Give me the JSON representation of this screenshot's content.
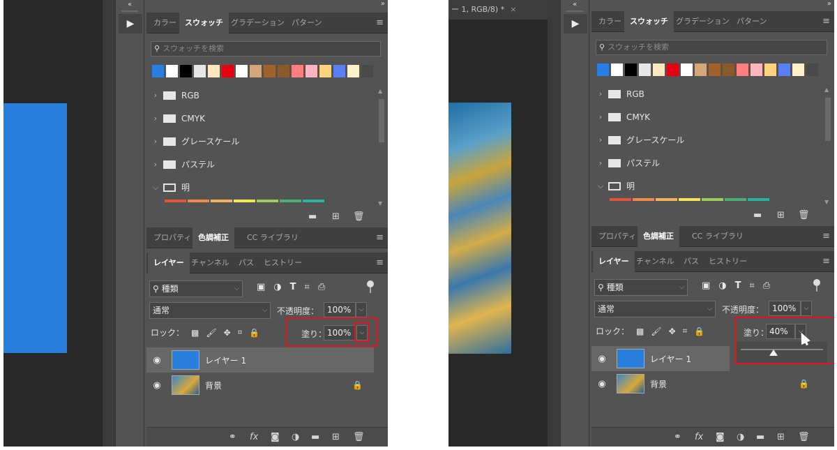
{
  "colors": {
    "fill_layer": "#2b7fdc",
    "highlight": "#e0141e",
    "panel_bg": "#535353",
    "canvas_bg": "#282828"
  },
  "left": {
    "collapse_icon": "«",
    "expand_icon": "»",
    "play_icon": "▶",
    "swatch_tabs": [
      "カラー",
      "スウォッチ",
      "グラデーション",
      "パターン"
    ],
    "swatch_search_placeholder": "スウォッチを検索",
    "swatch_colors": [
      "#2a7de1",
      "#ffffff",
      "#000000",
      "#e6e6e6",
      "#ffe8c0",
      "#e60012",
      "#ffffff",
      "#d4a77a",
      "#a0622d",
      "#8b5a2b",
      "#ff7f7f",
      "#ffb5c0",
      "#ffd27f",
      "#5a7ff0",
      "#fff0cc"
    ],
    "folders": [
      {
        "label": "RGB",
        "open": false
      },
      {
        "label": "CMYK",
        "open": false
      },
      {
        "label": "グレースケール",
        "open": false
      },
      {
        "label": "パステル",
        "open": false
      },
      {
        "label": "明",
        "open": true
      }
    ],
    "adjust_tabs": [
      "プロパティ",
      "色調補正",
      "CC ライブラリ"
    ],
    "layer_tabs": [
      "レイヤー",
      "チャンネル",
      "パス",
      "ヒストリー"
    ],
    "filter_kind": "種類",
    "blend_mode": "通常",
    "opacity_label": "不透明度：",
    "opacity_value": "100%",
    "lock_label": "ロック：",
    "fill_label": "塗り：",
    "fill_value": "100%",
    "layers": [
      {
        "name": "レイヤー 1",
        "selected": true,
        "locked": false
      },
      {
        "name": "背景",
        "selected": false,
        "locked": true
      }
    ]
  },
  "right": {
    "doc_tab_title": "ー 1, RGB/8) *",
    "doc_tab_close": "×",
    "collapse_icon": "«",
    "expand_icon": "»",
    "play_icon": "▶",
    "swatch_tabs": [
      "カラー",
      "スウォッチ",
      "グラデーション",
      "パターン"
    ],
    "swatch_search_placeholder": "スウォッチを検索",
    "swatch_colors": [
      "#2a7de1",
      "#ffffff",
      "#000000",
      "#e6e6e6",
      "#ffe8c0",
      "#e60012",
      "#ffffff",
      "#d4a77a",
      "#a0622d",
      "#8b5a2b",
      "#ff7f7f",
      "#ffb5c0",
      "#ffd27f",
      "#5a7ff0",
      "#fff0cc"
    ],
    "folders": [
      {
        "label": "RGB",
        "open": false
      },
      {
        "label": "CMYK",
        "open": false
      },
      {
        "label": "グレースケール",
        "open": false
      },
      {
        "label": "パステル",
        "open": false
      },
      {
        "label": "明",
        "open": true
      }
    ],
    "adjust_tabs": [
      "プロパティ",
      "色調補正",
      "CC ライブラリ"
    ],
    "layer_tabs": [
      "レイヤー",
      "チャンネル",
      "パス",
      "ヒストリー"
    ],
    "filter_kind": "種類",
    "blend_mode": "通常",
    "opacity_label": "不透明度：",
    "opacity_value": "100%",
    "lock_label": "ロック：",
    "fill_label": "塗り：",
    "fill_value": "40%",
    "fill_slider_level": 0.4,
    "layers": [
      {
        "name": "レイヤー 1",
        "selected": true,
        "locked": false
      },
      {
        "name": "背景",
        "selected": false,
        "locked": true
      }
    ]
  },
  "swatch_strip_colors": [
    "#e0543a",
    "#f08a4b",
    "#f6b25a",
    "#f3e55a",
    "#9ccc5a",
    "#4caf7a",
    "#2bb3a0"
  ],
  "icons": {
    "search": "search-icon",
    "folder": "folder-icon",
    "eye": "eye-icon",
    "lock": "lock-icon",
    "trash": "trash-icon",
    "new": "new-icon",
    "link": "link-icon",
    "fx": "fx-icon"
  },
  "footer_fx_label": "fx"
}
